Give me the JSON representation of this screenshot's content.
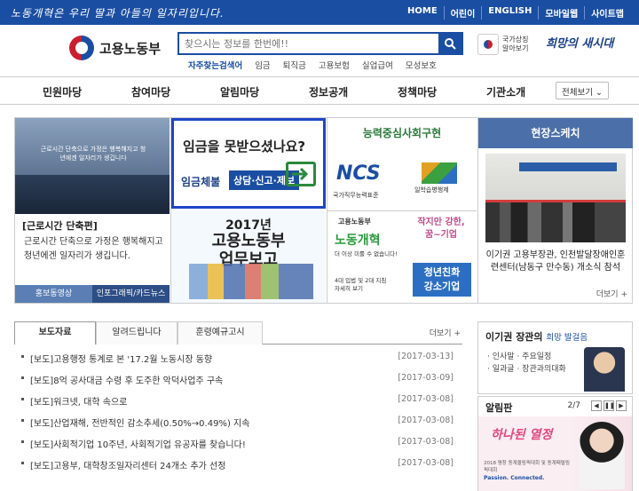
{
  "topbar": {
    "slogan": "노동개혁은 우리 딸과 아들의 일자리입니다.",
    "links": [
      "HOME",
      "어린이",
      "ENGLISH",
      "모바일웹",
      "사이트맵"
    ]
  },
  "header": {
    "logo_text": "고용노동부",
    "search_placeholder": "찾으시는 정보를 한번에!!",
    "keywords_lead": "자주찾는검색어",
    "keywords": [
      "임금",
      "퇴직금",
      "고용보험",
      "실업급여",
      "모성보호"
    ],
    "emblem_text_1": "국가상징",
    "emblem_text_2": "알아보기",
    "slogan_right": "희망의 새시대"
  },
  "gnb": {
    "items": [
      "민원마당",
      "참여마당",
      "알림마당",
      "정보공개",
      "정책마당",
      "기관소개"
    ],
    "all_label": "전체보기"
  },
  "banner1": {
    "caption": "근로시간 단축으로 가정은 행복해지고 청년에겐 일자리가 생깁니다",
    "brand": "고용노동부",
    "title": "[근로시간 단축편]",
    "desc": "근로시간 단축으로 가정은 행복해지고 청년에겐 일자리가 생깁니다.",
    "tab1": "홍보동영상",
    "tab2": "인포그래픽/카드뉴스"
  },
  "banner2": {
    "question": "임금을 못받으셨나요?",
    "label": "임금체불",
    "pill": "상담·신고·제보",
    "year": "2017년",
    "big1": "고용노동부",
    "big2": "업무보고"
  },
  "banner3": {
    "head": "능력중심사회구현",
    "ncs": "NCS",
    "ncs_sub": "국가직무능력표준",
    "learn": "일학습병행제",
    "logo": "고용노동부",
    "labor": "노동개혁",
    "labor_sub": "더 이상 미룰 수 없습니다!",
    "tag1": "4대 입법 및 2대 지침",
    "tag2": "자세히 보기",
    "headline1": "작지만 강한,",
    "headline2": "꿈~기업",
    "blue1": "청년친화",
    "blue2": "강소기업"
  },
  "banner4": {
    "head": "현장스케치",
    "caption": "이기권 고용부장관, 인천발달장애인훈련센터(남동구 만수동) 개소식 참석",
    "more": "더보기 +"
  },
  "news": {
    "tabs": [
      "보도자료",
      "알려드립니다",
      "훈령예규고시"
    ],
    "more": "더보기 +",
    "items": [
      {
        "title": "[보도]고용행정 통계로 본 '17.2월 노동시장 동향",
        "date": "[2017-03-13]"
      },
      {
        "title": "[보도]8억 공사대금 수령 후 도주한 악덕사업주 구속",
        "date": "[2017-03-09]"
      },
      {
        "title": "[보도]워크넷, 대학 속으로",
        "date": "[2017-03-08]"
      },
      {
        "title": "[보도]산업재해, 전반적인 감소추세(0.50%→0.49%) 지속",
        "date": "[2017-03-08]"
      },
      {
        "title": "[보도]사회적기업 10주년, 사회적기업 유공자를 찾습니다!",
        "date": "[2017-03-08]"
      },
      {
        "title": "[보도]고용부, 대학창조일자리센터 24개소 추가 선정",
        "date": "[2017-03-08]"
      }
    ]
  },
  "minister": {
    "name": "이기권 장관의",
    "sub": "희망 발걸음",
    "items": [
      "· 인사말",
      "· 주요일정",
      "· 일과글",
      "· 장관과의대화"
    ]
  },
  "notice": {
    "title": "알림판",
    "page": "2/7",
    "poster_title": "하나된 열정",
    "poster_desc": "2018 평창 동계올림픽대회 및 동계패럴림픽대회",
    "poster_slogan": "Passion. Connected."
  }
}
